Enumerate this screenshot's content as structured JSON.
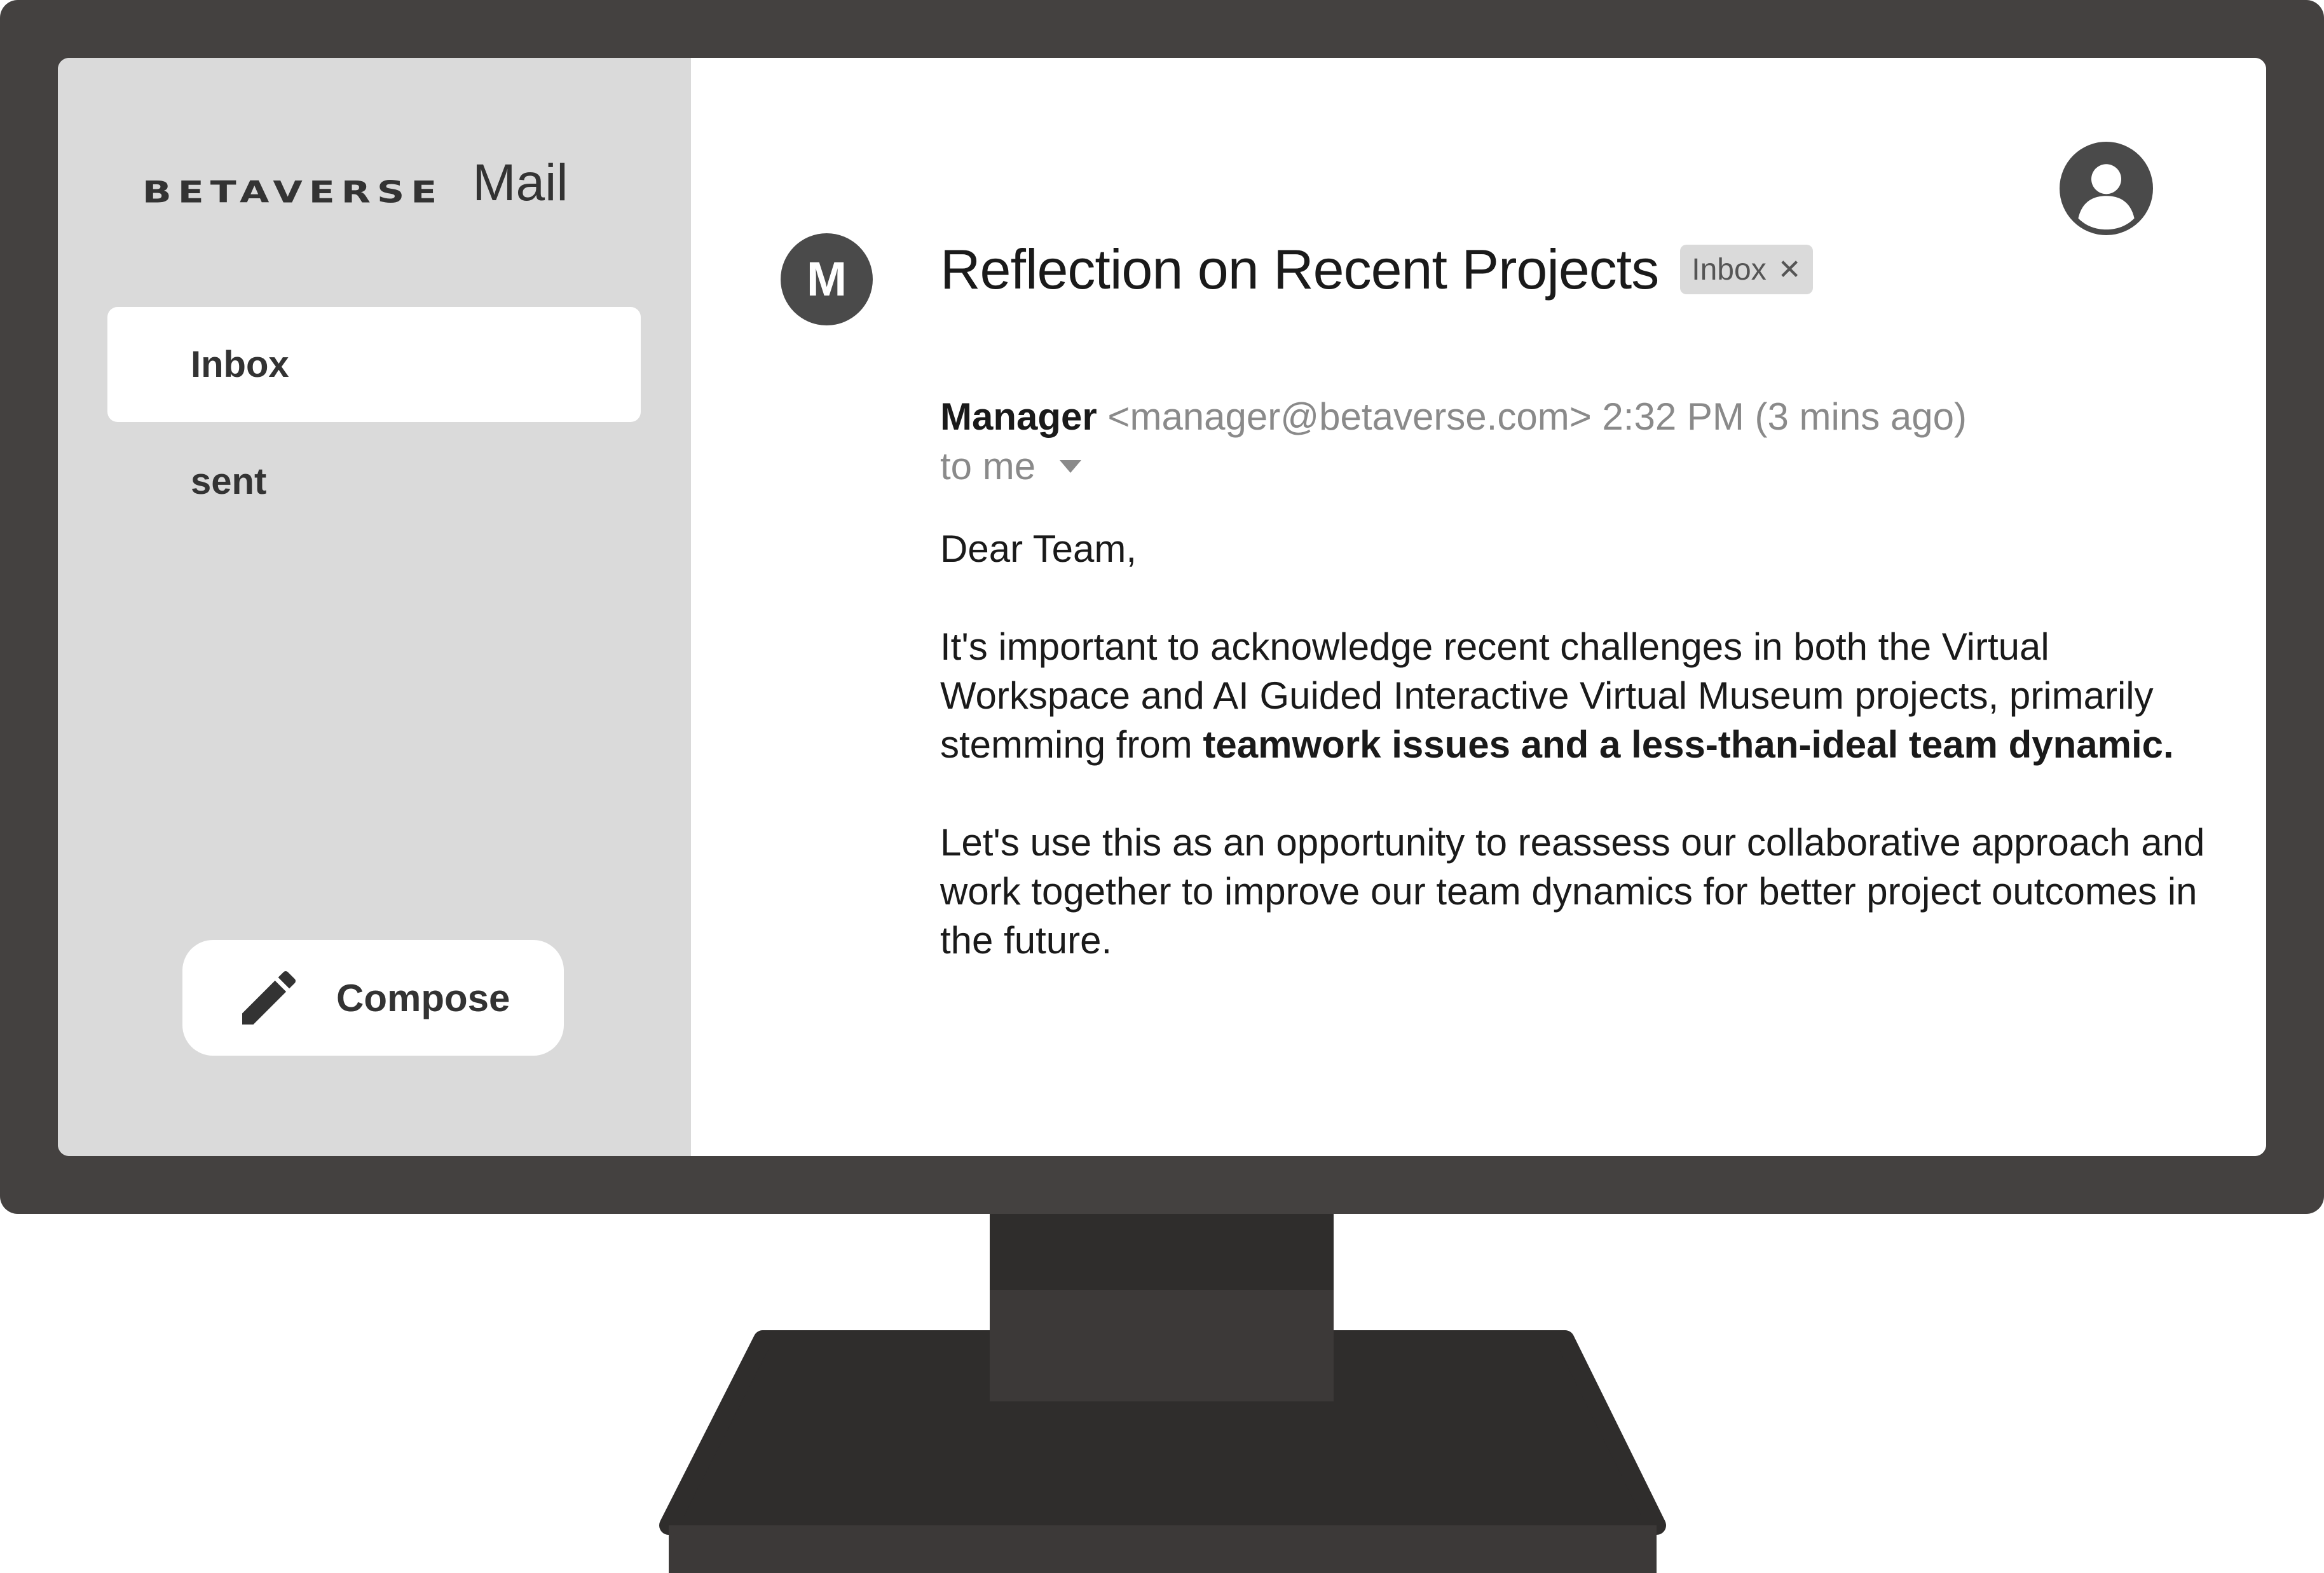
{
  "brand": {
    "logo_text": "BETAVERSE",
    "app_name": "Mail"
  },
  "sidebar": {
    "items": [
      {
        "label": "Inbox",
        "active": true
      },
      {
        "label": "sent",
        "active": false
      }
    ],
    "compose_label": "Compose"
  },
  "email": {
    "subject": "Reflection on Recent Projects",
    "label_tag": "Inbox",
    "sender_initial": "M",
    "sender_name": "Manager",
    "sender_email": "<manager@betaverse.com>",
    "time": "2:32 PM (3 mins ago)",
    "recipient": "to me",
    "greeting": "Dear Team,",
    "paragraph1_plain": "It's important to acknowledge recent challenges in both the Virtual Workspace and AI Guided Interactive Virtual Museum projects, primarily stemming from ",
    "paragraph1_bold": "teamwork issues and a less-than-ideal team dynamic.",
    "paragraph2": "Let's use this as an opportunity to reassess our collaborative approach and work together to improve our team dynamics for better project outcomes in the future."
  },
  "icons": {
    "compose": "pencil-icon",
    "account": "account-circle-icon",
    "tag_close": "close-icon",
    "recipient_dropdown": "caret-down-icon"
  },
  "colors": {
    "bezel": "#444140",
    "sidebar": "#dadada",
    "avatar": "#4a4a4a",
    "text_dark": "#1a1a1a",
    "text_muted": "#8a8a8a"
  }
}
